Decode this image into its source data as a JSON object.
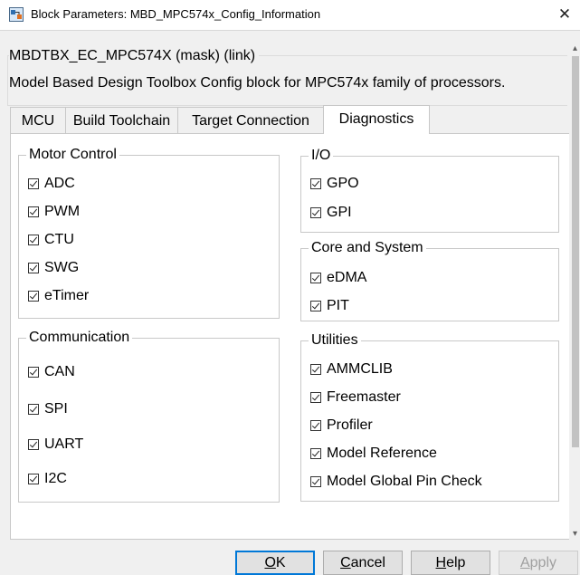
{
  "window": {
    "title": "Block Parameters: MBD_MPC574x_Config_Information",
    "close_glyph": "✕"
  },
  "mask": {
    "label": "MBDTBX_EC_MPC574X (mask) (link)",
    "description": "Model Based Design Toolbox Config block for MPC574x family of processors."
  },
  "tabs": [
    {
      "label": "MCU",
      "active": false
    },
    {
      "label": "Build Toolchain",
      "active": false
    },
    {
      "label": "Target Connection",
      "active": false
    },
    {
      "label": "Diagnostics",
      "active": true
    }
  ],
  "groups": {
    "motor_control": {
      "title": "Motor Control",
      "items": [
        {
          "label": "ADC",
          "checked": true
        },
        {
          "label": "PWM",
          "checked": true
        },
        {
          "label": "CTU",
          "checked": true
        },
        {
          "label": "SWG",
          "checked": true
        },
        {
          "label": "eTimer",
          "checked": true
        }
      ]
    },
    "communication": {
      "title": "Communication",
      "items": [
        {
          "label": "CAN",
          "checked": true
        },
        {
          "label": "SPI",
          "checked": true
        },
        {
          "label": "UART",
          "checked": true
        },
        {
          "label": "I2C",
          "checked": true
        }
      ]
    },
    "io": {
      "title": "I/O",
      "items": [
        {
          "label": "GPO",
          "checked": true
        },
        {
          "label": "GPI",
          "checked": true
        }
      ]
    },
    "core_system": {
      "title": "Core and System",
      "items": [
        {
          "label": "eDMA",
          "checked": true
        },
        {
          "label": "PIT",
          "checked": true
        }
      ]
    },
    "utilities": {
      "title": "Utilities",
      "items": [
        {
          "label": "AMMCLIB",
          "checked": true
        },
        {
          "label": "Freemaster",
          "checked": true
        },
        {
          "label": "Profiler",
          "checked": true
        },
        {
          "label": "Model Reference",
          "checked": true
        },
        {
          "label": "Model Global Pin Check",
          "checked": true
        }
      ]
    }
  },
  "buttons": {
    "ok": {
      "mnemonic": "O",
      "rest": "K"
    },
    "cancel": {
      "mnemonic": "C",
      "rest": "ancel"
    },
    "help": {
      "mnemonic": "H",
      "rest": "elp"
    },
    "apply": {
      "mnemonic": "A",
      "rest": "pply"
    }
  },
  "icons": {
    "app": "block-parameters-icon",
    "scroll_up": "chevron-up-icon",
    "scroll_down": "chevron-down-icon"
  },
  "colors": {
    "accent": "#0078d7",
    "window_bg": "#f0f0f0",
    "panel_bg": "#ffffff"
  }
}
